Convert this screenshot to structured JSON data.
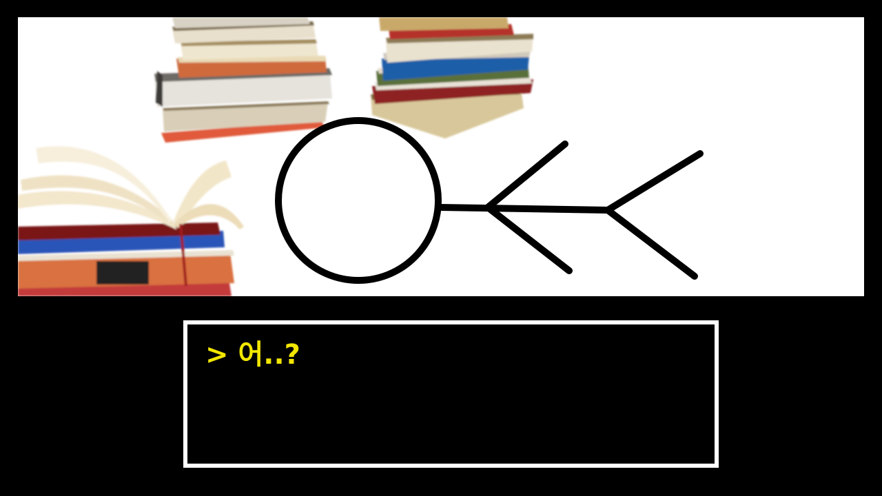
{
  "scene": {
    "description_icons": [
      "books-stack-icon",
      "open-book-icon",
      "stick-figure-icon"
    ]
  },
  "dialog": {
    "prompt": ">",
    "text": "어..?"
  },
  "colors": {
    "background": "#000000",
    "scene_background": "#ffffff",
    "dialog_border": "#ffffff",
    "dialog_text": "#f2e600",
    "figure_stroke": "#000000"
  }
}
